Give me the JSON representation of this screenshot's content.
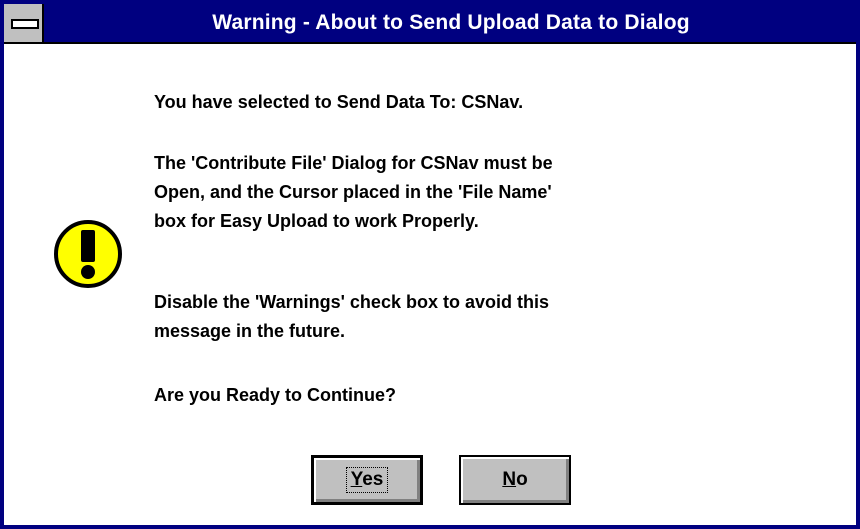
{
  "dialog": {
    "title": "Warning - About to Send Upload Data to Dialog",
    "icon": "exclamation-icon",
    "colors": {
      "titlebar": "#000080",
      "icon_fill": "#ffff00",
      "button_face": "#c0c0c0"
    },
    "messages": [
      "You have selected to Send Data To: CSNav.",
      "The 'Contribute File' Dialog for CSNav must be",
      "Open, and the Cursor placed in the 'File Name'",
      "box for Easy Upload to work Properly.",
      "Disable the 'Warnings' check box to avoid this",
      "message in the future.",
      "Are you Ready to Continue?"
    ],
    "buttons": {
      "yes_mnemonic": "Y",
      "yes_rest": "es",
      "no_mnemonic": "N",
      "no_rest": "o"
    }
  }
}
